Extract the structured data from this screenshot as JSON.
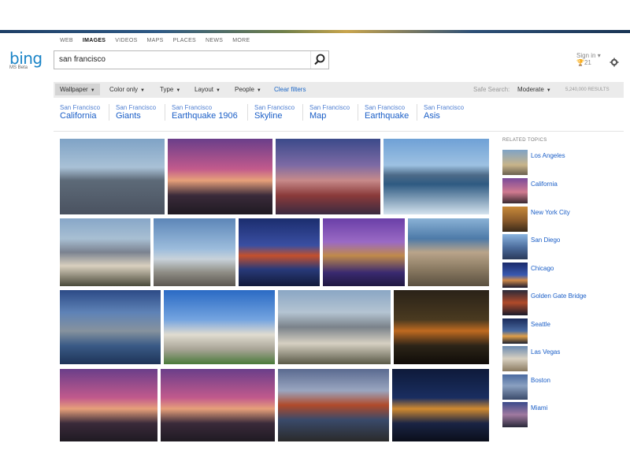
{
  "nav": [
    "WEB",
    "IMAGES",
    "VIDEOS",
    "MAPS",
    "PLACES",
    "NEWS",
    "MORE"
  ],
  "logo": {
    "word": "bing",
    "beta": "MS Beta"
  },
  "search": {
    "query": "san francisco"
  },
  "user": {
    "signin": "Sign in",
    "points": "21"
  },
  "filters": {
    "wallpaper": "Wallpaper",
    "color": "Color only",
    "type": "Type",
    "layout": "Layout",
    "people": "People",
    "clear": "Clear filters",
    "safe_label": "Safe Search:",
    "safe_value": "Moderate",
    "results": "5,240,000 RESULTS"
  },
  "related_searches": [
    {
      "small": "San Francisco",
      "big": "California"
    },
    {
      "small": "San Francisco",
      "big": "Giants"
    },
    {
      "small": "San Francisco",
      "big": "Earthquake 1906"
    },
    {
      "small": "San Francisco",
      "big": "Skyline"
    },
    {
      "small": "San Francisco",
      "big": "Map"
    },
    {
      "small": "San Francisco",
      "big": "Earthquake"
    },
    {
      "small": "San Francisco",
      "big": "Asis"
    }
  ],
  "related_topics_header": "RELATED TOPICS",
  "related_topics": [
    "Los Angeles",
    "California",
    "New York City",
    "San Diego",
    "Chicago",
    "Golden Gate Bridge",
    "Seattle",
    "Las Vegas",
    "Boston",
    "Miami"
  ]
}
